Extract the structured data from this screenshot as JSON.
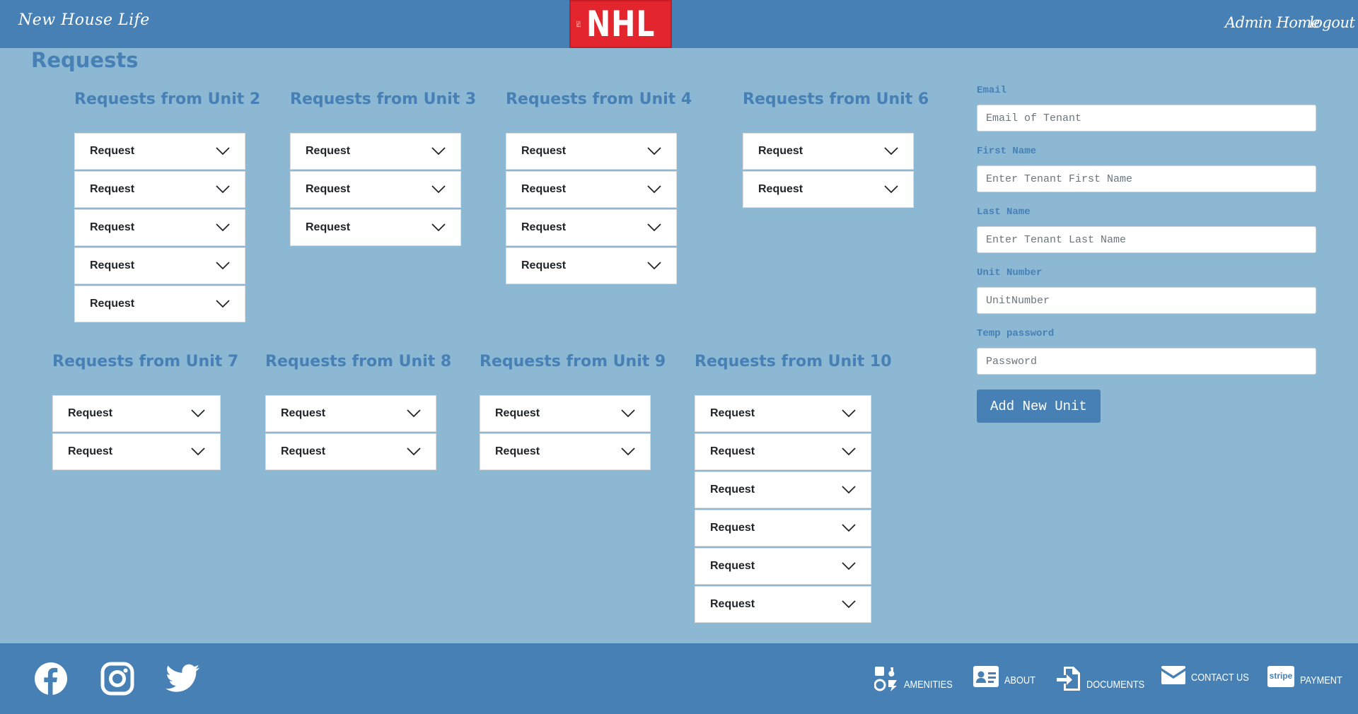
{
  "header": {
    "brand": "New House Life",
    "logo_text": "NHL",
    "nav": {
      "admin_home": "Admin Home",
      "logout": "logout"
    }
  },
  "page": {
    "title": "Requests"
  },
  "units": [
    {
      "title": "Requests from Unit 2",
      "requests": [
        "Request",
        "Request",
        "Request",
        "Request",
        "Request"
      ]
    },
    {
      "title": "Requests from Unit 3",
      "requests": [
        "Request",
        "Request",
        "Request"
      ]
    },
    {
      "title": "Requests from Unit 4",
      "requests": [
        "Request",
        "Request",
        "Request",
        "Request"
      ]
    },
    {
      "title": "Requests from Unit 6",
      "requests": [
        "Request",
        "Request"
      ]
    },
    {
      "title": "Requests from Unit 7",
      "requests": [
        "Request",
        "Request"
      ]
    },
    {
      "title": "Requests from Unit 8",
      "requests": [
        "Request",
        "Request"
      ]
    },
    {
      "title": "Requests from Unit 9",
      "requests": [
        "Request",
        "Request"
      ]
    },
    {
      "title": "Requests from Unit 10",
      "requests": [
        "Request",
        "Request",
        "Request",
        "Request",
        "Request",
        "Request"
      ]
    }
  ],
  "form": {
    "email": {
      "label": "Email",
      "placeholder": "Email of Tenant"
    },
    "first_name": {
      "label": "First Name",
      "placeholder": "Enter Tenant First Name"
    },
    "last_name": {
      "label": "Last Name",
      "placeholder": "Enter Tenant Last Name"
    },
    "unit_number": {
      "label": "Unit Number",
      "placeholder": "UnitNumber"
    },
    "temp_password": {
      "label": "Temp password",
      "placeholder": "Password"
    },
    "submit_label": "Add New Unit"
  },
  "footer": {
    "social": [
      "facebook-icon",
      "instagram-icon",
      "twitter-icon"
    ],
    "links": [
      {
        "label": "AMENITIES",
        "icon": "amenities-icon"
      },
      {
        "label": "ABOUT",
        "icon": "id-card-icon"
      },
      {
        "label": "DOCUMENTS",
        "icon": "file-import-icon"
      },
      {
        "label": "CONTACT US",
        "icon": "envelope-icon"
      },
      {
        "label": "PAYMENT",
        "icon": "stripe-icon"
      }
    ]
  },
  "colors": {
    "header": "#4680b5",
    "background": "#8cb8d4",
    "logo": "#e3252d",
    "accent": "#4680b5"
  }
}
